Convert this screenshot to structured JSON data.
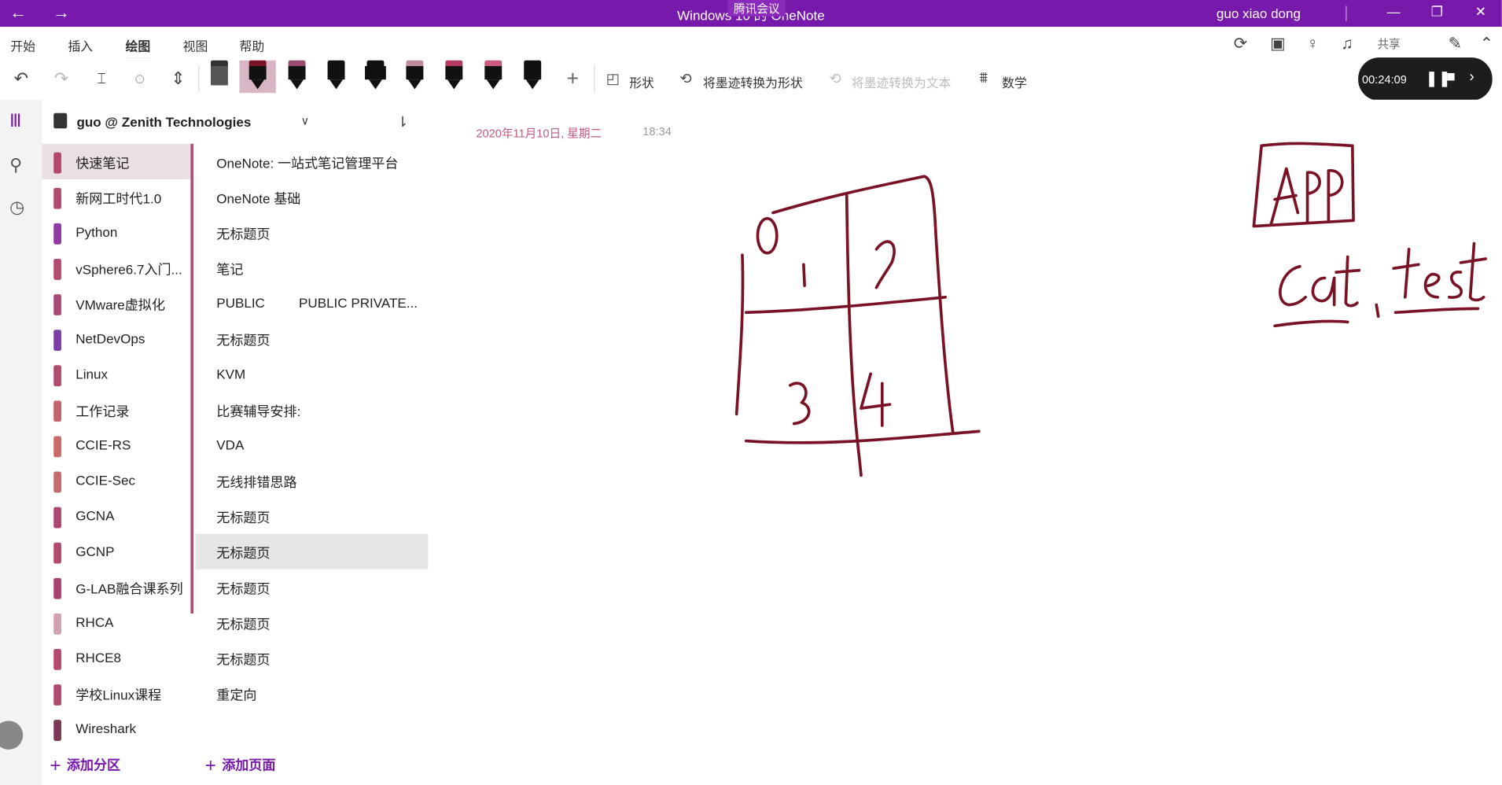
{
  "titlebar": {
    "back": "←",
    "forward": "→",
    "title": "Windows 10 的 OneNote",
    "meeting": "腾讯会议",
    "user": "guo xiao dong",
    "minimize": "—",
    "restore": "❐",
    "close": "✕"
  },
  "tabs": [
    "开始",
    "插入",
    "绘图",
    "视图",
    "帮助"
  ],
  "share_label": "共享",
  "ribbon": {
    "shapes": "形状",
    "ink_to_shape": "将墨迹转换为形状",
    "ink_to_text": "将墨迹转换为文本",
    "math": "数学"
  },
  "recording": {
    "time": "00:24:09"
  },
  "notebook": {
    "name": "guo @ Zenith Technologies"
  },
  "sections": [
    {
      "label": "快速笔记",
      "color": "#b4476f"
    },
    {
      "label": "新网工时代1.0",
      "color": "#b14a6c"
    },
    {
      "label": "Python",
      "color": "#8f3aa3"
    },
    {
      "label": "vSphere6.7入门...",
      "color": "#b24b6b"
    },
    {
      "label": "VMware虚拟化",
      "color": "#a94a75"
    },
    {
      "label": "NetDevOps",
      "color": "#7b3ea5"
    },
    {
      "label": "Linux",
      "color": "#b04c6e"
    },
    {
      "label": "工作记录",
      "color": "#c2646a"
    },
    {
      "label": "CCIE-RS",
      "color": "#c86a69"
    },
    {
      "label": "CCIE-Sec",
      "color": "#c36c6a"
    },
    {
      "label": "GCNA",
      "color": "#ae4870"
    },
    {
      "label": "GCNP",
      "color": "#b24a6c"
    },
    {
      "label": "G-LAB融合课系列",
      "color": "#a9446f"
    },
    {
      "label": "RHCA",
      "color": "#d0a2b0"
    },
    {
      "label": "RHCE8",
      "color": "#b44a6b"
    },
    {
      "label": "学校Linux课程",
      "color": "#b04a6e"
    },
    {
      "label": "Wireshark",
      "color": "#7a3a55"
    }
  ],
  "pages": [
    {
      "label": "OneNote: 一站式笔记管理平台"
    },
    {
      "label": "OneNote 基础"
    },
    {
      "label": "无标题页"
    },
    {
      "label": "笔记"
    },
    {
      "label": "PUBLIC",
      "label2": "PUBLIC PRIVATE..."
    },
    {
      "label": "无标题页"
    },
    {
      "label": "KVM"
    },
    {
      "label": "比赛辅导安排:"
    },
    {
      "label": "VDA"
    },
    {
      "label": "无线排错思路"
    },
    {
      "label": "无标题页"
    },
    {
      "label": "无标题页"
    },
    {
      "label": "无标题页"
    },
    {
      "label": "无标题页"
    },
    {
      "label": "无标题页"
    },
    {
      "label": "重定向"
    }
  ],
  "add_section": "添加分区",
  "add_page": "添加页面",
  "page_meta": {
    "date": "2020年11月10日, 星期二",
    "time": "18:34"
  },
  "colors": {
    "brand": "#7719aa",
    "ink": "#7a1226"
  }
}
